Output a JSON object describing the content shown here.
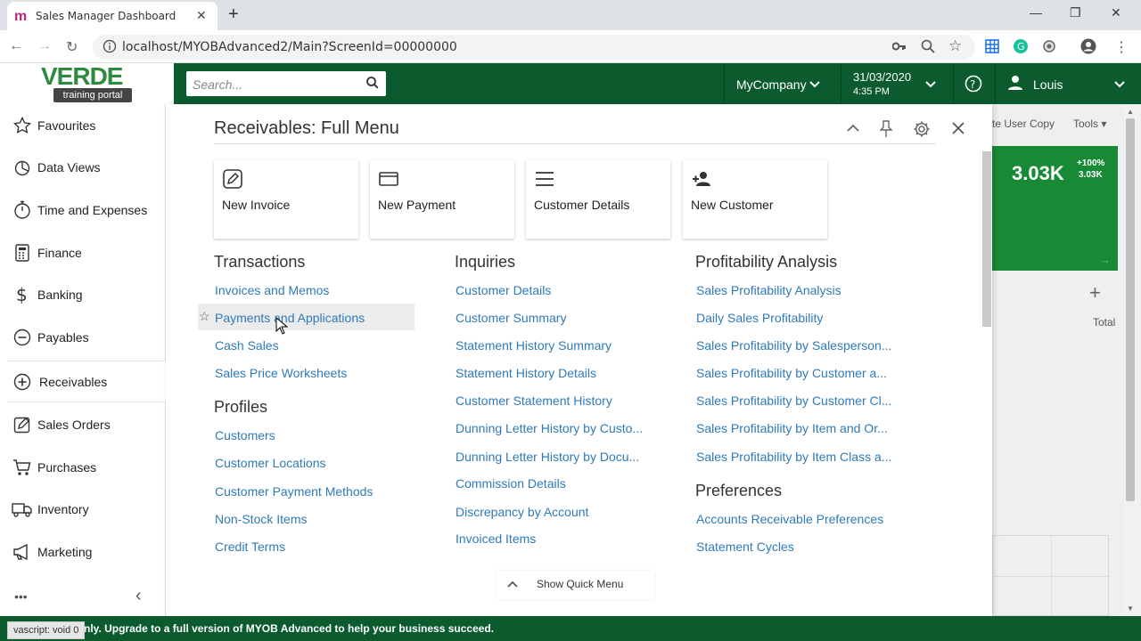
{
  "browser": {
    "tab_title": "Sales Manager Dashboard",
    "url": "localhost/MYOBAdvanced2/Main?ScreenId=00000000",
    "favicon": "m",
    "close_glyph": "✕",
    "new_tab_glyph": "+"
  },
  "header": {
    "logo_word": "VERDE",
    "logo_sub": "training portal",
    "search_placeholder": "Search...",
    "company": "MyCompany",
    "date": "31/03/2020",
    "time": "4:35 PM",
    "user": "Louis"
  },
  "sidebar": {
    "items": [
      {
        "label": "Favourites",
        "icon": "star-icon"
      },
      {
        "label": "Data Views",
        "icon": "pie-chart-icon"
      },
      {
        "label": "Time and Expenses",
        "icon": "stopwatch-icon"
      },
      {
        "label": "Finance",
        "icon": "calculator-icon"
      },
      {
        "label": "Banking",
        "icon": "dollar-icon"
      },
      {
        "label": "Payables",
        "icon": "minus-circle-icon"
      },
      {
        "label": "Receivables",
        "icon": "plus-circle-icon"
      },
      {
        "label": "Sales Orders",
        "icon": "edit-icon"
      },
      {
        "label": "Purchases",
        "icon": "cart-icon"
      },
      {
        "label": "Inventory",
        "icon": "truck-icon"
      },
      {
        "label": "Marketing",
        "icon": "megaphone-icon"
      }
    ],
    "active": "Receivables",
    "more": "•••",
    "collapse": "‹"
  },
  "panel": {
    "title": "Receivables: Full Menu",
    "quick": [
      {
        "label": "New Invoice",
        "icon": "edit-icon"
      },
      {
        "label": "New Payment",
        "icon": "card-icon"
      },
      {
        "label": "Customer Details",
        "icon": "list-icon"
      },
      {
        "label": "New Customer",
        "icon": "add-person-icon"
      }
    ],
    "transactions": {
      "title": "Transactions",
      "items": [
        "Invoices and Memos",
        "Payments and Applications",
        "Cash Sales",
        "Sales Price Worksheets"
      ]
    },
    "profiles": {
      "title": "Profiles",
      "items": [
        "Customers",
        "Customer Locations",
        "Customer Payment Methods",
        "Non-Stock Items",
        "Credit Terms"
      ]
    },
    "inquiries": {
      "title": "Inquiries",
      "items": [
        "Customer Details",
        "Customer Summary",
        "Statement History Summary",
        "Statement History Details",
        "Customer Statement History",
        "Dunning Letter History by Custo...",
        "Dunning Letter History by Docu...",
        "Commission Details",
        "Discrepancy by Account",
        "Invoiced Items"
      ]
    },
    "profitability": {
      "title": "Profitability Analysis",
      "items": [
        "Sales Profitability Analysis",
        "Daily Sales Profitability",
        "Sales Profitability by Salesperson...",
        "Sales Profitability by Customer a...",
        "Sales Profitability by Customer Cl...",
        "Sales Profitability by Item and Or...",
        "Sales Profitability by Item Class a..."
      ]
    },
    "preferences": {
      "title": "Preferences",
      "items": [
        "Accounts Receivable Preferences",
        "Statement Cycles"
      ]
    },
    "show_quick": "Show Quick Menu"
  },
  "background": {
    "toolbar_a": "te User Copy",
    "toolbar_b": "Tools",
    "kpi_value": "3.03K",
    "kpi_pct": "+100%",
    "kpi_sub": "3.03K",
    "total": "Total",
    "plus": "+"
  },
  "footer": {
    "status": "vascript: void 0",
    "banner": "nly. Upgrade to a full version of MYOB Advanced to help your business succeed."
  }
}
